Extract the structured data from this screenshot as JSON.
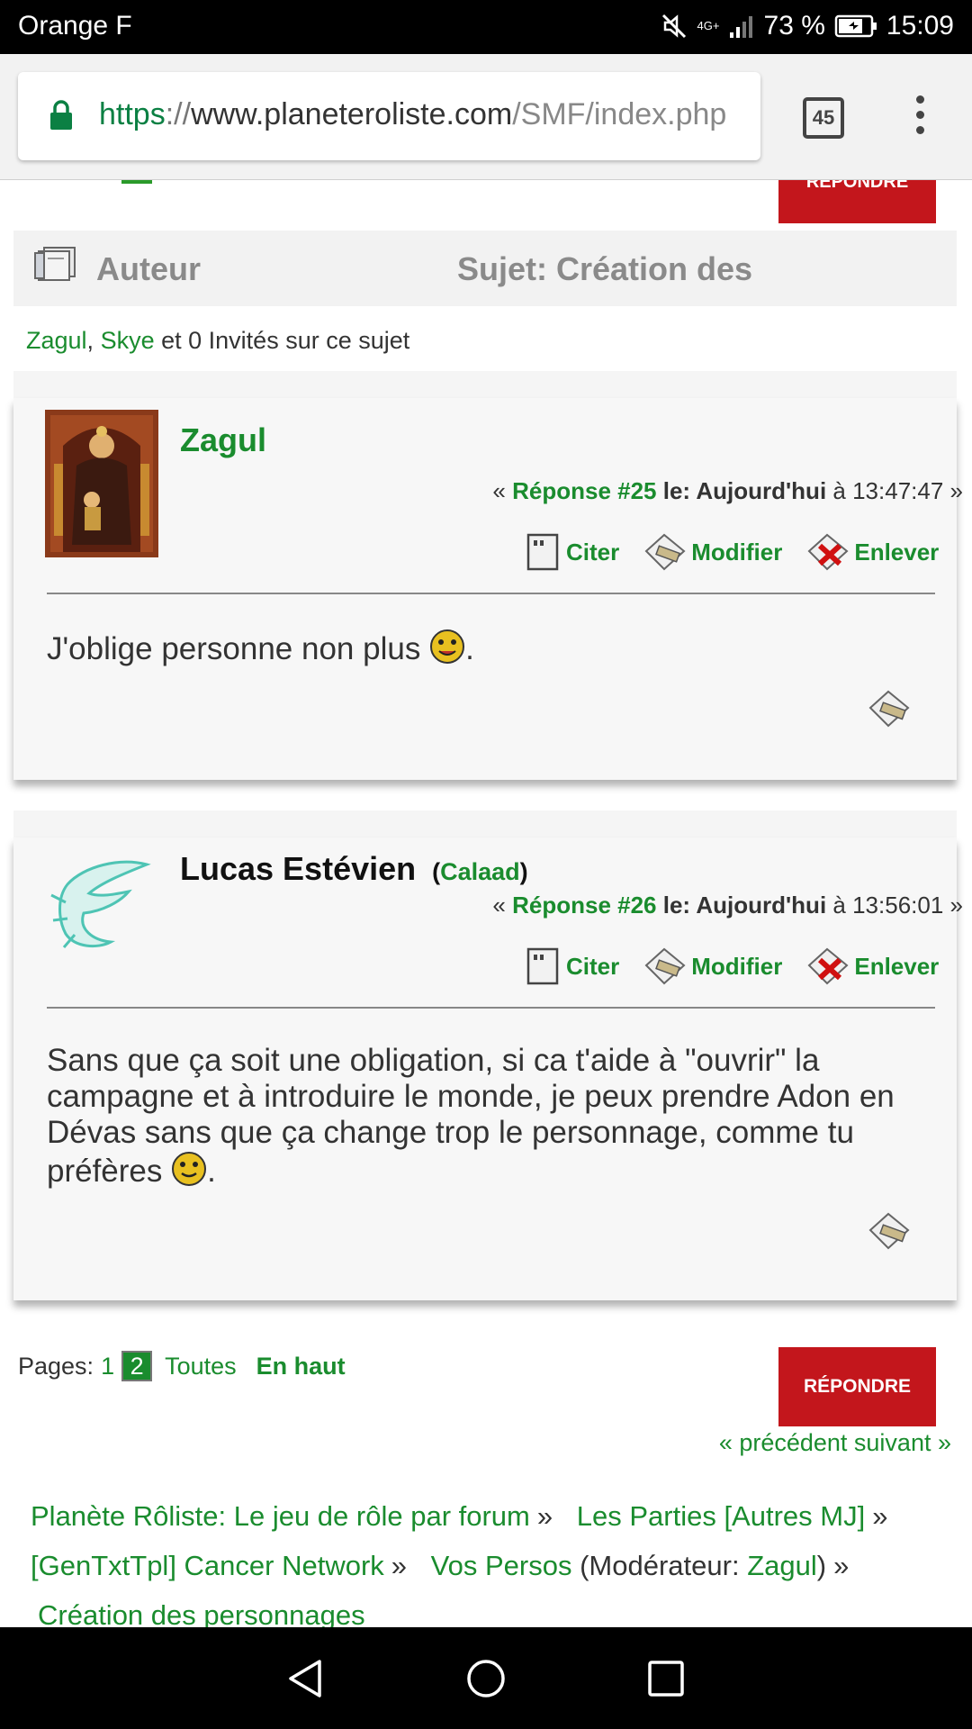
{
  "status": {
    "carrier": "Orange F",
    "network": "4G+",
    "battery": "73 %",
    "time": "15:09"
  },
  "browser": {
    "url_scheme": "https",
    "url_sep": "://",
    "url_host": "www.planeteroliste.com",
    "url_path": "/SMF/index.php",
    "tab_count": "45"
  },
  "forum": {
    "reply_label": "RÉPONDRE",
    "header_author": "Auteur",
    "header_subject": "Sujet:  Création des",
    "viewers": {
      "user1": "Zagul",
      "comma": ",",
      "user2": "Skye",
      "rest": "et 0 Invités sur ce sujet"
    }
  },
  "posts": [
    {
      "author": "Zagul",
      "alias": "",
      "reply_open": "«",
      "reply_num": "Réponse #25",
      "reply_le": "le: Aujourd'hui",
      "reply_time": "à 13:47:47",
      "reply_close": "»",
      "actions": {
        "quote": "Citer",
        "edit": "Modifier",
        "remove": "Enlever"
      },
      "body": "J'oblige personne non plus",
      "body_end": "."
    },
    {
      "author": "Lucas Estévien",
      "alias_open": "(",
      "alias": "Calaad",
      "alias_close": ")",
      "reply_open": "«",
      "reply_num": "Réponse #26",
      "reply_le": "le: Aujourd'hui",
      "reply_time": "à 13:56:01",
      "reply_close": "»",
      "actions": {
        "quote": "Citer",
        "edit": "Modifier",
        "remove": "Enlever"
      },
      "body": "Sans que ça soit une obligation, si ca t'aide à \"ouvrir\" la campagne et à introduire le monde, je peux prendre Adon en Dévas sans que ça change trop le personnage, comme tu préfères",
      "body_end": "."
    }
  ],
  "pagination": {
    "label": "Pages:",
    "page1": "1",
    "current": "2",
    "all": "Toutes",
    "top": "En haut"
  },
  "prevnext": "« précédent suivant »",
  "breadcrumb": {
    "b1": "Planète Rôliste: Le jeu de rôle par forum",
    "b2": "Les Parties [Autres MJ]",
    "b3": "[GenTxtTpl] Cancer Network",
    "b4": "Vos Persos",
    "mod_open": "(Modérateur:",
    "mod_name": "Zagul",
    "mod_close": ")",
    "b5": "Création des personnages",
    "sep": "»"
  },
  "colors": {
    "link_green": "#1a8c2e",
    "reply_red": "#c3161c",
    "status_bg": "#000000"
  },
  "icons": [
    "mute-icon",
    "signal-icon",
    "battery-icon",
    "lock-icon",
    "tabs-icon",
    "overflow-menu-icon",
    "topic-icon",
    "quote-icon",
    "edit-icon",
    "remove-icon",
    "report-icon",
    "smiley-icon",
    "back-icon",
    "home-icon",
    "recents-icon"
  ]
}
